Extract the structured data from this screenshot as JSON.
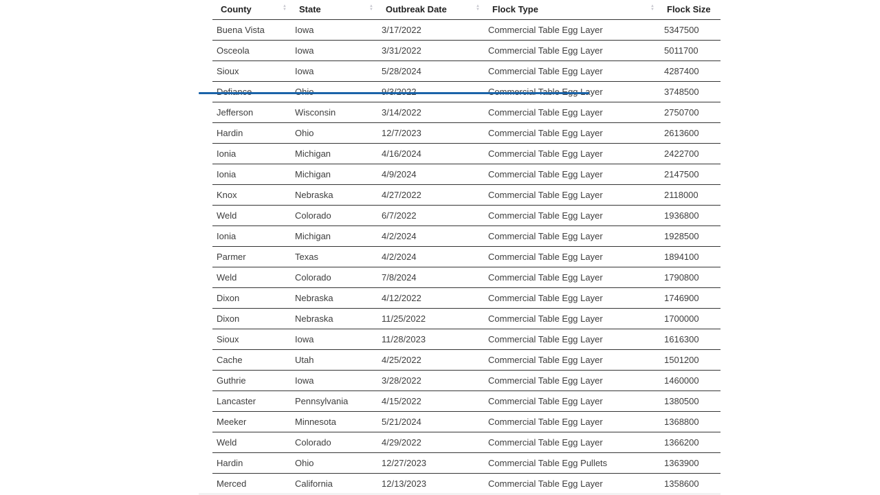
{
  "table": {
    "headers": [
      "County",
      "State",
      "Outbreak Date",
      "Flock Type",
      "Flock Size"
    ],
    "rows": [
      [
        "Buena Vista",
        "Iowa",
        "3/17/2022",
        "Commercial Table Egg Layer",
        "5347500"
      ],
      [
        "Osceola",
        "Iowa",
        "3/31/2022",
        "Commercial Table Egg Layer",
        "5011700"
      ],
      [
        "Sioux",
        "Iowa",
        "5/28/2024",
        "Commercial Table Egg Layer",
        "4287400"
      ],
      [
        "Defiance",
        "Ohio",
        "9/3/2022",
        "Commercial Table Egg Layer",
        "3748500"
      ],
      [
        "Jefferson",
        "Wisconsin",
        "3/14/2022",
        "Commercial Table Egg Layer",
        "2750700"
      ],
      [
        "Hardin",
        "Ohio",
        "12/7/2023",
        "Commercial Table Egg Layer",
        "2613600"
      ],
      [
        "Ionia",
        "Michigan",
        "4/16/2024",
        "Commercial Table Egg Layer",
        "2422700"
      ],
      [
        "Ionia",
        "Michigan",
        "4/9/2024",
        "Commercial Table Egg Layer",
        "2147500"
      ],
      [
        "Knox",
        "Nebraska",
        "4/27/2022",
        "Commercial Table Egg Layer",
        "2118000"
      ],
      [
        "Weld",
        "Colorado",
        "6/7/2022",
        "Commercial Table Egg Layer",
        "1936800"
      ],
      [
        "Ionia",
        "Michigan",
        "4/2/2024",
        "Commercial Table Egg Layer",
        "1928500"
      ],
      [
        "Parmer",
        "Texas",
        "4/2/2024",
        "Commercial Table Egg Layer",
        "1894100"
      ],
      [
        "Weld",
        "Colorado",
        "7/8/2024",
        "Commercial Table Egg Layer",
        "1790800"
      ],
      [
        "Dixon",
        "Nebraska",
        "4/12/2022",
        "Commercial Table Egg Layer",
        "1746900"
      ],
      [
        "Dixon",
        "Nebraska",
        "11/25/2022",
        "Commercial Table Egg Layer",
        "1700000"
      ],
      [
        "Sioux",
        "Iowa",
        "11/28/2023",
        "Commercial Table Egg Layer",
        "1616300"
      ],
      [
        "Cache",
        "Utah",
        "4/25/2022",
        "Commercial Table Egg Layer",
        "1501200"
      ],
      [
        "Guthrie",
        "Iowa",
        "3/28/2022",
        "Commercial Table Egg Layer",
        "1460000"
      ],
      [
        "Lancaster",
        "Pennsylvania",
        "4/15/2022",
        "Commercial Table Egg Layer",
        "1380500"
      ],
      [
        "Meeker",
        "Minnesota",
        "5/21/2024",
        "Commercial Table Egg Layer",
        "1368800"
      ],
      [
        "Weld",
        "Colorado",
        "4/29/2022",
        "Commercial Table Egg Layer",
        "1366200"
      ],
      [
        "Hardin",
        "Ohio",
        "12/27/2023",
        "Commercial Table Egg Pullets",
        "1363900"
      ],
      [
        "Merced",
        "California",
        "12/13/2023",
        "Commercial Table Egg Layer",
        "1358600"
      ]
    ]
  },
  "icons": {
    "sort": "sort-arrows-icon",
    "sort_up_glyph": "▲",
    "sort_down_glyph": "▼"
  },
  "colors": {
    "annotation_line": "#1a63a8",
    "row_border": "#333333",
    "sort_icon": "#c8c8d0"
  }
}
